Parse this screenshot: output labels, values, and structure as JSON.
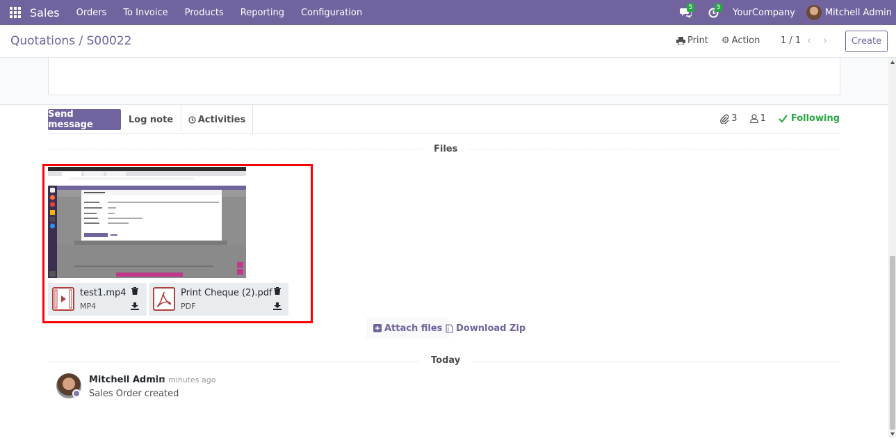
{
  "navbar": {
    "brand": "Sales",
    "menu": [
      "Orders",
      "To Invoice",
      "Products",
      "Reporting",
      "Configuration"
    ],
    "messages_count": "5",
    "activities_count": "3",
    "company": "YourCompany",
    "user": "Mitchell Admin"
  },
  "control_panel": {
    "breadcrumb_parent": "Quotations",
    "breadcrumb_sep": "/",
    "breadcrumb_current": "S00022",
    "print_label": "Print",
    "action_label": "Action",
    "pager": "1 / 1",
    "create_label": "Create"
  },
  "chatter": {
    "send_message": "Send message",
    "log_note": "Log note",
    "activities": "Activities",
    "attachments_count": "3",
    "followers_count": "1",
    "following_label": "Following",
    "files_label": "Files",
    "attachments": [
      {
        "name": "test1.mp4",
        "type": "MP4",
        "icon": "video-file-icon"
      },
      {
        "name": "Print Cheque (2).pdf",
        "type": "PDF",
        "icon": "pdf-file-icon"
      }
    ],
    "attach_files": "Attach files",
    "download_zip": "Download Zip",
    "today_label": "Today",
    "message": {
      "author": "Mitchell Admin",
      "date": "- 2 minutes ago",
      "body": "Sales Order created"
    }
  },
  "colors": {
    "brand_purple": "#71639e",
    "following_green": "#28a745",
    "highlight_red": "#ff0000"
  }
}
